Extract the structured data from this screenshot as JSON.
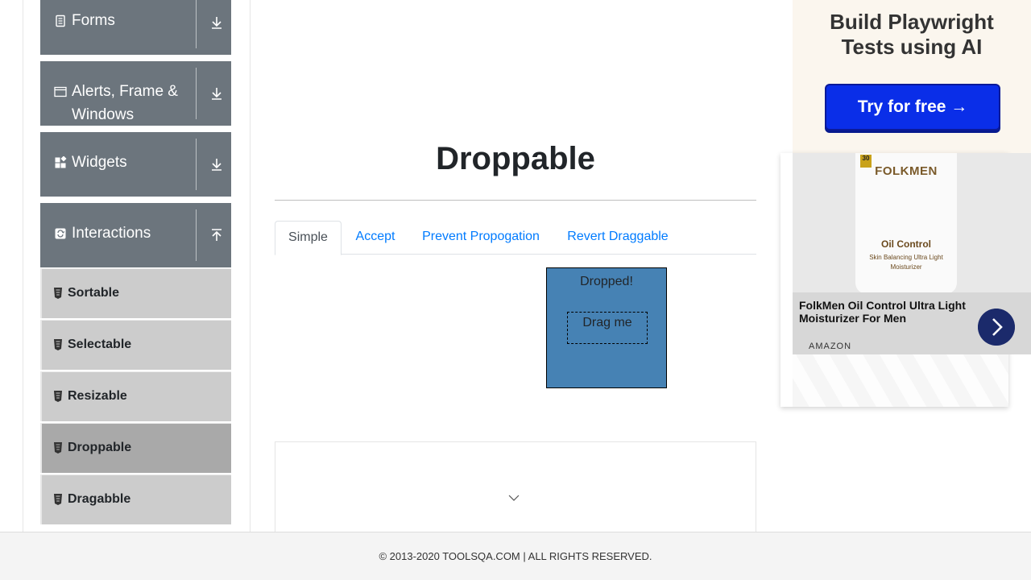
{
  "sidebar": {
    "groups": [
      {
        "label": "Forms",
        "icon": "document-icon",
        "state": "collapsed"
      },
      {
        "label1": "Alerts, Frame &",
        "label2": "Windows",
        "icon": "window-icon",
        "state": "collapsed"
      },
      {
        "label": "Widgets",
        "icon": "widgets-icon",
        "state": "collapsed"
      },
      {
        "label": "Interactions",
        "icon": "refresh-icon",
        "state": "expanded"
      }
    ],
    "items": [
      {
        "label": "Sortable",
        "active": false
      },
      {
        "label": "Selectable",
        "active": false
      },
      {
        "label": "Resizable",
        "active": false
      },
      {
        "label": "Droppable",
        "active": true
      },
      {
        "label": "Dragabble",
        "active": false
      }
    ]
  },
  "main": {
    "title": "Droppable",
    "tabs": [
      {
        "label": "Simple",
        "active": true
      },
      {
        "label": "Accept",
        "active": false
      },
      {
        "label": "Prevent Propogation",
        "active": false
      },
      {
        "label": "Revert Draggable",
        "active": false
      }
    ],
    "droppable_label": "Dropped!",
    "draggable_label": "Drag me"
  },
  "ads": {
    "top_heading_line1": "Build Playwright",
    "top_heading_line2": "Tests using AI",
    "top_button": "Try for free →",
    "product_brand": "FOLKMEN",
    "product_line1": "Oil Control",
    "product_line2": "Skin Balancing Ultra Light Moisturizer",
    "product_title": "FolkMen Oil Control Ultra Light Moisturizer For Men",
    "product_source": "AMAZON"
  },
  "footer": {
    "copyright": "© 2013-2020 TOOLSQA.COM | ALL RIGHTS RESERVED."
  },
  "colors": {
    "group_bg": "#6c757d",
    "item_bg": "#cccccc",
    "item_active_bg": "#a9a9a9",
    "drop_bg": "#4682b4",
    "link": "#007bff"
  }
}
